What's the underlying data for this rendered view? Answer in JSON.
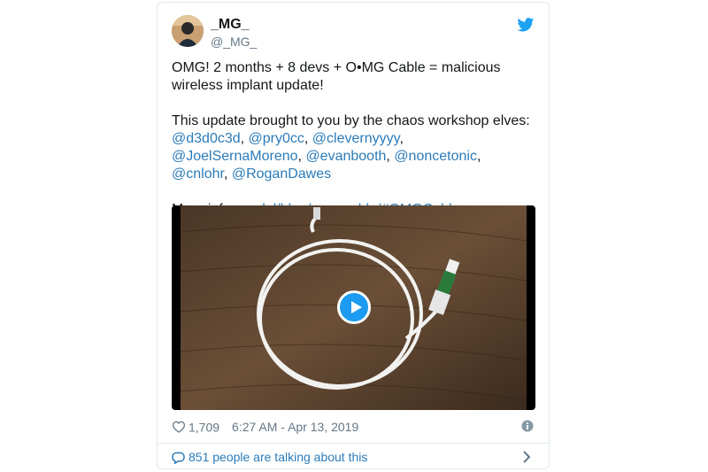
{
  "tweet": {
    "author_name": "_MG_",
    "author_handle": "@_MG_",
    "text_line1": "OMG! 2 months + 8 devs + O•MG Cable = malicious wireless implant update!",
    "text_line2": "This update brought to you by the chaos workshop elves:",
    "mentions": [
      "@d3d0c3d",
      "@pry0cc",
      "@clevernyyyy",
      "@JoelSernaMoreno",
      "@evanbooth",
      "@noncetonic",
      "@cnlohr",
      "@RoganDawes"
    ],
    "more_info_label": "More info:",
    "more_info_link": "mg.lol/blog/omg-cable/#OMGCable",
    "likes": "1,709",
    "timestamp": "6:27 AM - Apr 13, 2019",
    "talking": "851 people are talking about this"
  },
  "icons": {
    "brand": "twitter-bird-icon",
    "like": "heart-icon",
    "info": "info-icon",
    "reply": "speech-bubble-icon",
    "more": "chevron-right-icon",
    "play": "play-icon"
  },
  "colors": {
    "link": "#2b7bb9",
    "twitter_blue": "#1da1f2",
    "text": "#14171a",
    "muted": "#657786"
  }
}
